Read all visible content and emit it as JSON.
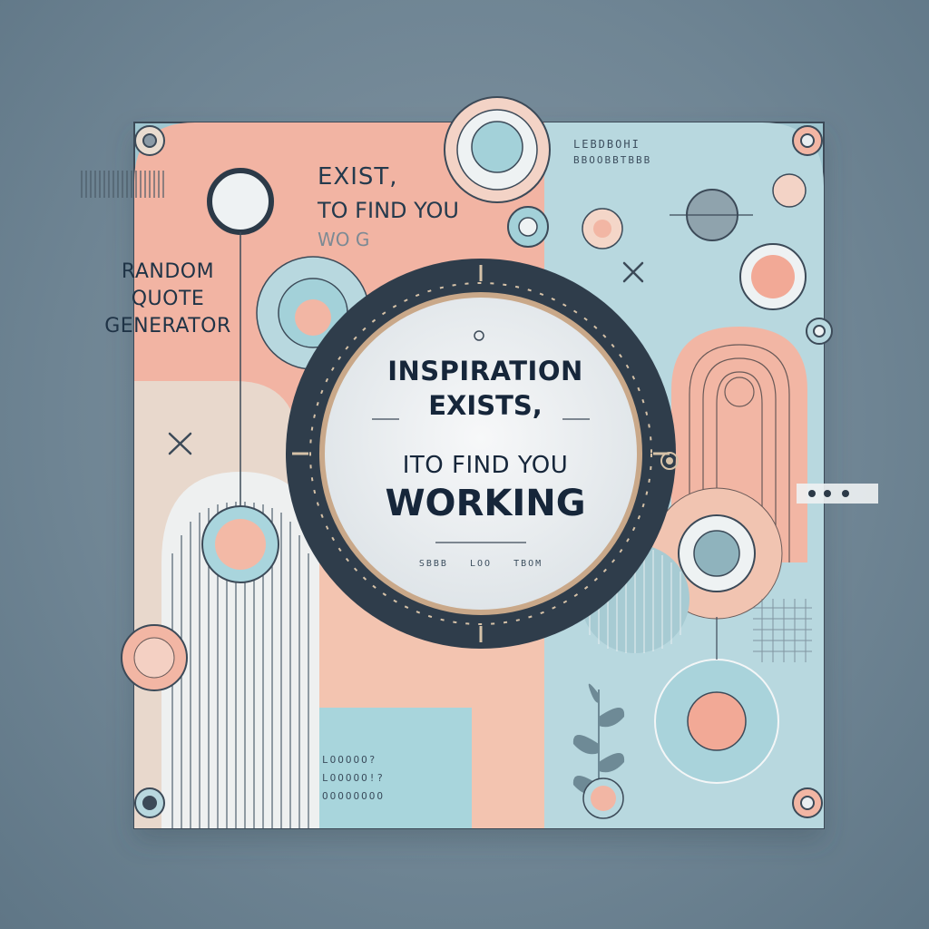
{
  "side_title": {
    "line1": "RANDOM",
    "line2": "QUOTE",
    "line3": "GENERATOR"
  },
  "background_quote": {
    "line1": "EXIST,",
    "line2": "TO FIND YOU",
    "line3": "WO    G"
  },
  "main_quote": {
    "line1": "INSPIRATION",
    "line2": "EXISTS,",
    "line3": "ITO FIND YOU",
    "line4": "WORKING"
  },
  "header_text": {
    "line1": "LEBDBOHI",
    "line2": "BBOOBBTBBB"
  },
  "dial_caption": "SBBB   LOO   TBOM",
  "footer_text": {
    "line1": "LOOOOO?",
    "line2": "LOOOOO!?",
    "line3": "OOOOOOOO"
  },
  "colors": {
    "pink": "#f2b6a4",
    "peach": "#f3c3b0",
    "blue": "#a9d4dc",
    "sky": "#bcdde3",
    "cream": "#eadcd0",
    "navy": "#2c3a48",
    "ring": "#3c4a58",
    "plate": "#e9eef1"
  }
}
